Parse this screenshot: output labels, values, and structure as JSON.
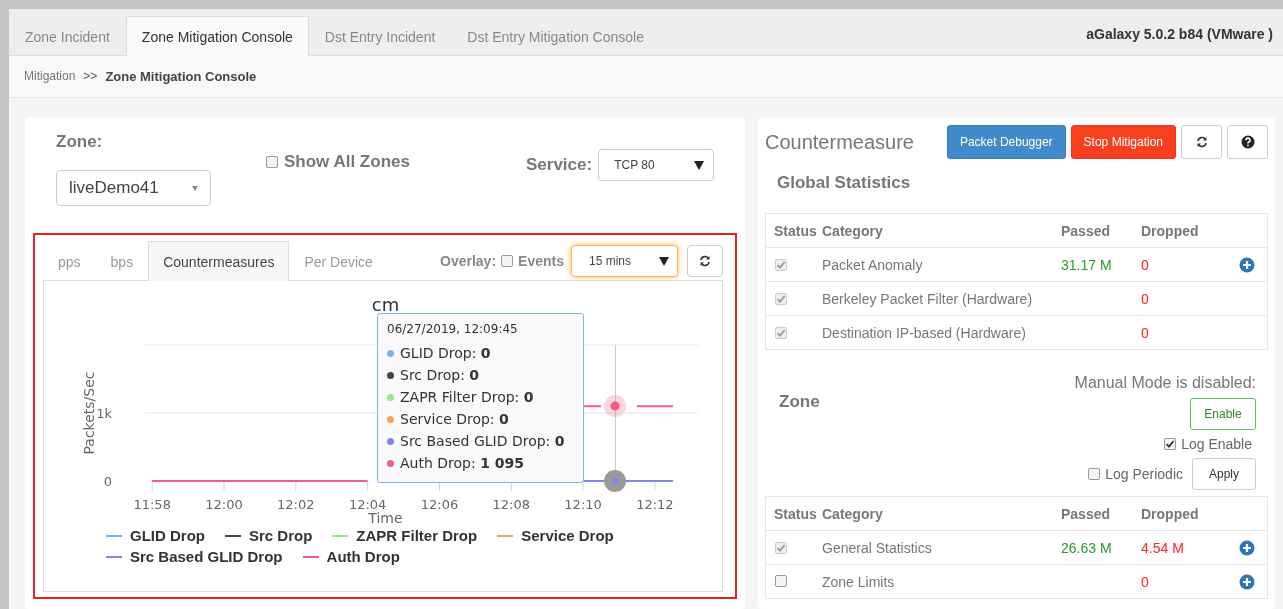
{
  "top_tabs": [
    {
      "label": "Zone Incident",
      "selected": false
    },
    {
      "label": "Zone Mitigation Console",
      "selected": true
    },
    {
      "label": "Dst Entry Incident",
      "selected": false
    },
    {
      "label": "Dst Entry Mitigation Console",
      "selected": false
    }
  ],
  "version": "aGalaxy 5.0.2 b84 (VMware )",
  "breadcrumb": {
    "items": [
      "Mitigation",
      "Zone Mitigation Console"
    ],
    "separator": ">>"
  },
  "zone_selector": {
    "label": "Zone:",
    "value": "liveDemo41"
  },
  "show_all_zones": {
    "label": "Show All Zones",
    "checked": false
  },
  "service": {
    "label": "Service:",
    "value": "TCP 80"
  },
  "chart_tabs": [
    {
      "label": "pps",
      "selected": false
    },
    {
      "label": "bps",
      "selected": false
    },
    {
      "label": "Countermeasures",
      "selected": true
    },
    {
      "label": "Per Device",
      "selected": false
    }
  ],
  "overlay": {
    "label": "Overlay:",
    "events_label": "Events",
    "events_checked": false
  },
  "time_range": {
    "value": "15 mins",
    "focused": true
  },
  "chart": {
    "chart_data": {
      "type": "line",
      "title": "cm",
      "xlabel": "Time",
      "ylabel": "Packets/Sec",
      "categories": [
        "11:58",
        null,
        null,
        null,
        "12:00",
        null,
        null,
        null,
        "12:02",
        null,
        null,
        null,
        "12:04",
        null,
        null,
        null,
        "12:06",
        null,
        null,
        null,
        "12:08",
        null,
        null,
        null,
        "12:10",
        null,
        null,
        null,
        "12:12",
        null
      ],
      "series": [
        {
          "name": "GLID Drop",
          "color": "#7cb5ec",
          "values": [
            null,
            null,
            null,
            null,
            null,
            null,
            null,
            null,
            null,
            null,
            null,
            null,
            null,
            null,
            null,
            null,
            null,
            null,
            null,
            null,
            null,
            null,
            null,
            null,
            null,
            null,
            null,
            null,
            null,
            null
          ]
        },
        {
          "name": "Src Drop",
          "color": "#434348",
          "values": [
            null,
            null,
            null,
            null,
            null,
            null,
            null,
            null,
            null,
            null,
            null,
            null,
            null,
            null,
            null,
            null,
            null,
            null,
            null,
            null,
            null,
            null,
            null,
            null,
            null,
            null,
            null,
            null,
            null,
            null
          ]
        },
        {
          "name": "ZAPR Filter Drop",
          "color": "#90ed7d",
          "values": [
            null,
            null,
            null,
            null,
            null,
            null,
            null,
            null,
            null,
            null,
            null,
            null,
            null,
            null,
            null,
            null,
            null,
            null,
            null,
            null,
            null,
            null,
            null,
            null,
            null,
            null,
            null,
            null,
            null,
            null
          ]
        },
        {
          "name": "Service Drop",
          "color": "#f7a35c",
          "values": [
            null,
            null,
            null,
            null,
            null,
            null,
            null,
            null,
            null,
            null,
            null,
            null,
            null,
            null,
            null,
            null,
            null,
            null,
            null,
            null,
            null,
            null,
            null,
            null,
            null,
            null,
            null,
            null,
            null,
            null
          ]
        },
        {
          "name": "Src Based GLID Drop",
          "color": "#8085e9",
          "values": [
            null,
            null,
            null,
            null,
            null,
            null,
            null,
            null,
            null,
            null,
            null,
            null,
            null,
            null,
            null,
            null,
            null,
            null,
            null,
            null,
            null,
            null,
            null,
            null,
            0,
            0,
            0,
            0,
            0,
            0
          ]
        },
        {
          "name": "Auth Drop",
          "color": "#f15c80",
          "values": [
            0,
            0,
            0,
            0,
            0,
            0,
            0,
            0,
            0,
            0,
            0,
            0,
            0,
            null,
            null,
            null,
            null,
            null,
            null,
            null,
            null,
            null,
            null,
            null,
            1100,
            1100,
            null,
            1100,
            1100,
            1100
          ]
        }
      ],
      "legend": "bottom",
      "ylim": [
        0,
        2000
      ],
      "yticks": [
        {
          "value": 0,
          "label": "0"
        },
        {
          "value": 1000,
          "label": "1k"
        }
      ]
    },
    "tooltip": {
      "time": "06/27/2019, 12:09:45",
      "items": [
        {
          "label": "GLID Drop:",
          "value": "0",
          "color": "#7cb5ec"
        },
        {
          "label": "Src Drop:",
          "value": "0",
          "color": "#434348"
        },
        {
          "label": "ZAPR Filter Drop:",
          "value": "0",
          "color": "#90ed7d"
        },
        {
          "label": "Service Drop:",
          "value": "0",
          "color": "#f7a35c"
        },
        {
          "label": "Src Based GLID Drop:",
          "value": "0",
          "color": "#8085e9"
        },
        {
          "label": "Auth Drop:",
          "value": "1 095",
          "color": "#f15c80"
        }
      ]
    }
  },
  "countermeasures": {
    "title": "Countermeasure",
    "buttons": [
      {
        "kind": "primary",
        "label": "Packet Debugger"
      },
      {
        "kind": "danger",
        "label": "Stop Mitigation"
      },
      {
        "kind": "refresh"
      },
      {
        "kind": "help"
      }
    ]
  },
  "global_statistics": {
    "title": "Global Statistics",
    "columns": [
      "Status",
      "Category",
      "Passed",
      "Dropped"
    ],
    "rows": [
      {
        "checked": true,
        "disabled": true,
        "category": "Packet Anomaly",
        "passed": "31.17 M",
        "dropped": "0",
        "expandable": true
      },
      {
        "checked": true,
        "disabled": true,
        "category": "Berkeley Packet Filter (Hardware)",
        "dropped": "0",
        "expandable": false
      },
      {
        "checked": true,
        "disabled": true,
        "category": "Destination IP-based (Hardware)",
        "dropped": "0",
        "expandable": false
      }
    ]
  },
  "zone": {
    "title": "Zone",
    "manual_mode": "Manual Mode is disabled:",
    "enable_button": "Enable",
    "log_enable": {
      "label": "Log Enable",
      "checked": true
    },
    "log_periodic": {
      "label": "Log Periodic",
      "checked": false
    },
    "apply_button": "Apply",
    "columns": [
      "Status",
      "Category",
      "Passed",
      "Dropped"
    ],
    "rows": [
      {
        "checked": true,
        "disabled": true,
        "category": "General Statistics",
        "passed": "26.63 M",
        "dropped": "4.54 M",
        "expandable": true
      },
      {
        "checked": false,
        "disabled": false,
        "category": "Zone Limits",
        "dropped": "0",
        "expandable": true
      }
    ]
  }
}
